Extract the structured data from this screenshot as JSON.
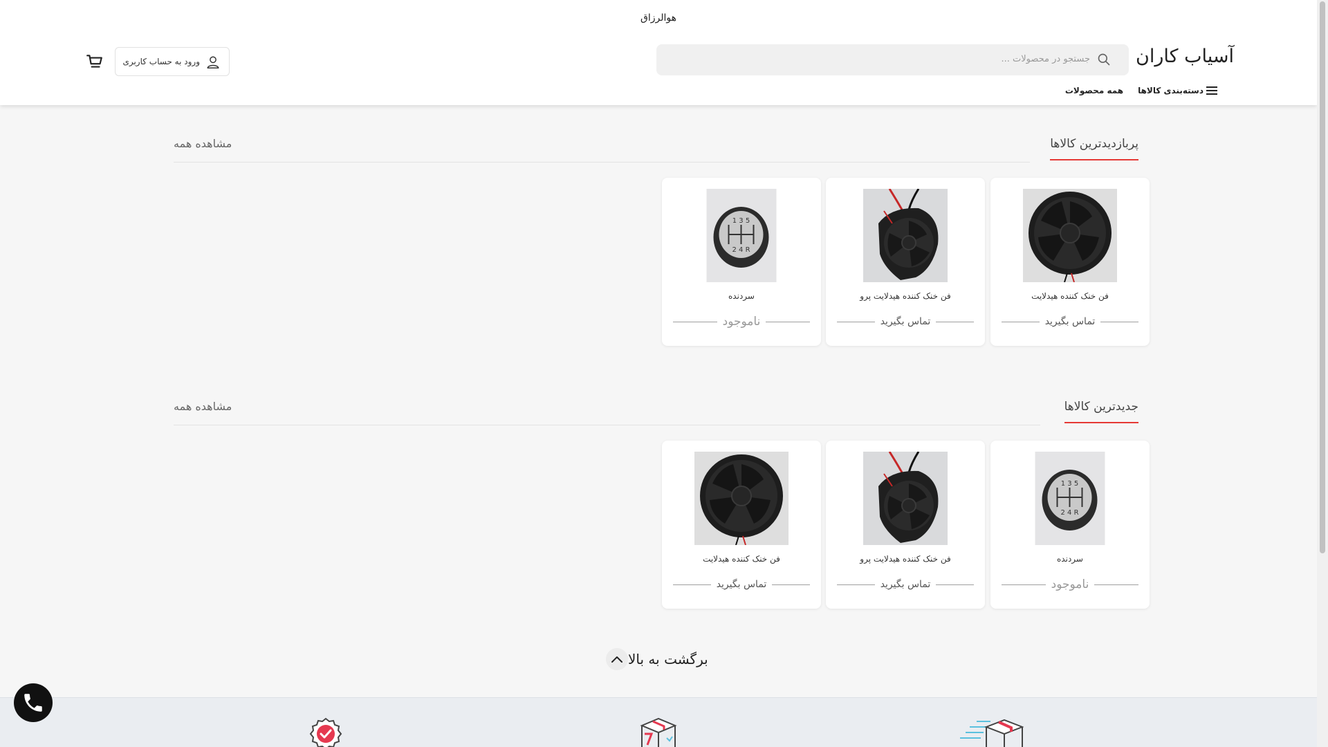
{
  "header": {
    "top_text": "هوالرزاق",
    "logo": "آسیاب کاران",
    "search_placeholder": "جستجو در محصولات ...",
    "login_label": "ورود به حساب کاربری",
    "nav": {
      "categories_label": "دسته‌بندی کالاها",
      "all_products_label": "همه محصولات"
    }
  },
  "sections": [
    {
      "title": "پربازدیدترین کالاها",
      "view_all": "مشاهده همه",
      "products": [
        {
          "name": "فن خنک کننده هیدلایت",
          "status": "تماس بگیرید",
          "image": "fan-front"
        },
        {
          "name": "فن خنک کننده هیدلایت پرو",
          "status": "تماس بگیرید",
          "image": "fan-pro"
        },
        {
          "name": "سردنده",
          "status": "ناموجود",
          "image": "gear-knob"
        }
      ]
    },
    {
      "title": "جدیدترین کالاها",
      "view_all": "مشاهده همه",
      "products": [
        {
          "name": "سردنده",
          "status": "ناموجود",
          "image": "gear-knob"
        },
        {
          "name": "فن خنک کننده هیدلایت پرو",
          "status": "تماس بگیرید",
          "image": "fan-pro"
        },
        {
          "name": "فن خنک کننده هیدلایت",
          "status": "تماس بگیرید",
          "image": "fan-front"
        }
      ]
    }
  ],
  "back_to_top": "برگشت به بالا",
  "gear_knob_digits": {
    "top": "1 3 5",
    "bottom": "2 4 R"
  },
  "colors": {
    "accent": "#e53935",
    "background": "#f6f6f6",
    "footer": "#eaedf1"
  }
}
